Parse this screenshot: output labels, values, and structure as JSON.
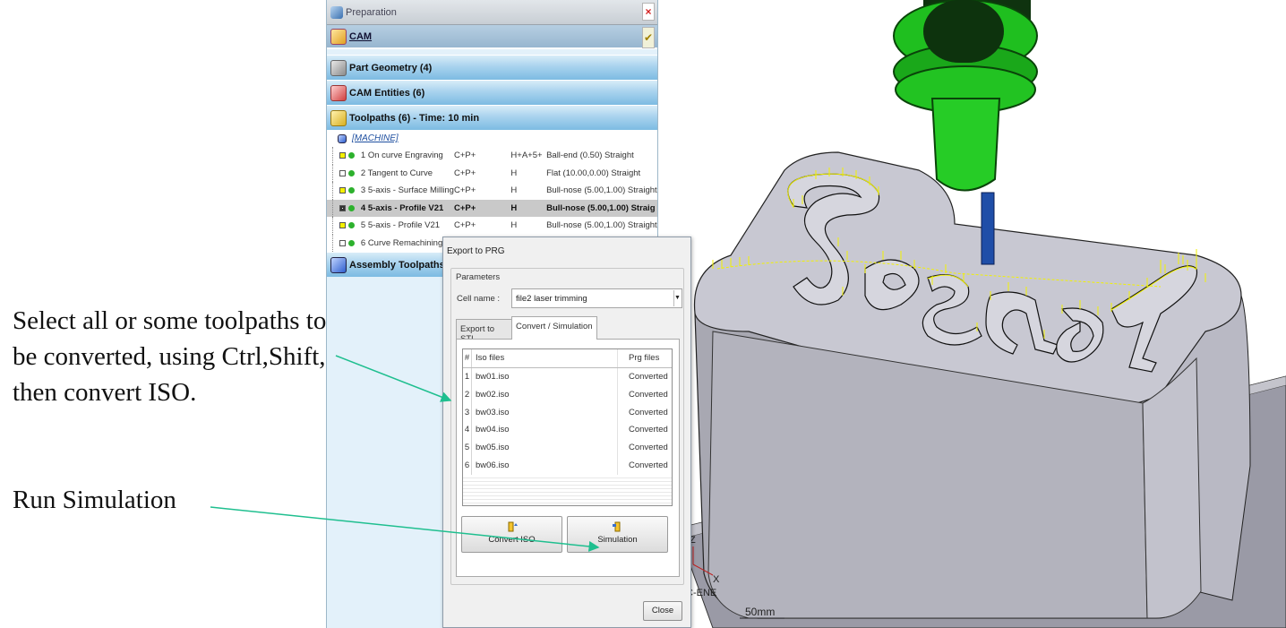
{
  "annotations": {
    "select_note": "Select all or some toolpaths to be converted, using Ctrl,Shift, then convert ISO.",
    "run_note": "Run Simulation"
  },
  "cam_panel": {
    "header_title": "Preparation",
    "cam_label": "CAM",
    "sections": {
      "part_geometry": "Part Geometry (4)",
      "cam_entities": "CAM Entities (6)",
      "toolpaths": "Toolpaths (6) - Time: 10 min",
      "assembly": "Assembly Toolpaths"
    },
    "machine_label": "[MACHINE]",
    "toolpaths": [
      {
        "name": "1 On curve Engraving",
        "dir": "C+P+",
        "axis": "H+A+5+",
        "tool": "Ball-end (0.50) Straight",
        "checked": false,
        "selected": false
      },
      {
        "name": "2 Tangent to Curve",
        "dir": "C+P+",
        "axis": "H",
        "tool": "Flat (10.00,0.00) Straight",
        "checked": false,
        "selected": false
      },
      {
        "name": "3 5-axis - Surface Milling",
        "dir": "C+P+",
        "axis": "H",
        "tool": "Bull-nose (5.00,1.00) Straight",
        "checked": false,
        "selected": false
      },
      {
        "name": "4 5-axis - Profile V21",
        "dir": "C+P+",
        "axis": "H",
        "tool": "Bull-nose (5.00,1.00) Straig",
        "checked": true,
        "selected": true
      },
      {
        "name": "5 5-axis - Profile V21",
        "dir": "C+P+",
        "axis": "H",
        "tool": "Bull-nose (5.00,1.00) Straight",
        "checked": false,
        "selected": false
      },
      {
        "name": "6 Curve Remachining",
        "dir": "",
        "axis": "",
        "tool": "",
        "checked": false,
        "selected": false
      }
    ]
  },
  "dialog": {
    "title": "Export to PRG",
    "parameters_label": "Parameters",
    "cell_name_label": "Cell name :",
    "cell_name_value": "file2 laser trimming",
    "tabs": [
      "Export to STL",
      "Convert / Simulation"
    ],
    "table_headers": {
      "num": "#",
      "iso": "Iso files",
      "prg": "Prg files"
    },
    "iso_rows": [
      {
        "n": "1",
        "file": "bw01.iso",
        "status": "Converted"
      },
      {
        "n": "2",
        "file": "bw02.iso",
        "status": "Converted"
      },
      {
        "n": "3",
        "file": "bw03.iso",
        "status": "Converted"
      },
      {
        "n": "4",
        "file": "bw04.iso",
        "status": "Converted"
      },
      {
        "n": "5",
        "file": "bw05.iso",
        "status": "Converted"
      },
      {
        "n": "6",
        "file": "bw06.iso",
        "status": "Converted"
      }
    ],
    "convert_button": "Convert ISO",
    "simulation_button": "Simulation",
    "close_button": "Close"
  },
  "viewport": {
    "scale_label": "50mm",
    "fixture_label": "C-ENE"
  },
  "colors": {
    "section_gradient": "#7cbbe2",
    "tool_holder": "#22c322",
    "toolpath_lines": "#f2f200",
    "arrow": "#1fbf8f",
    "part_body": "#b8b8c0"
  }
}
